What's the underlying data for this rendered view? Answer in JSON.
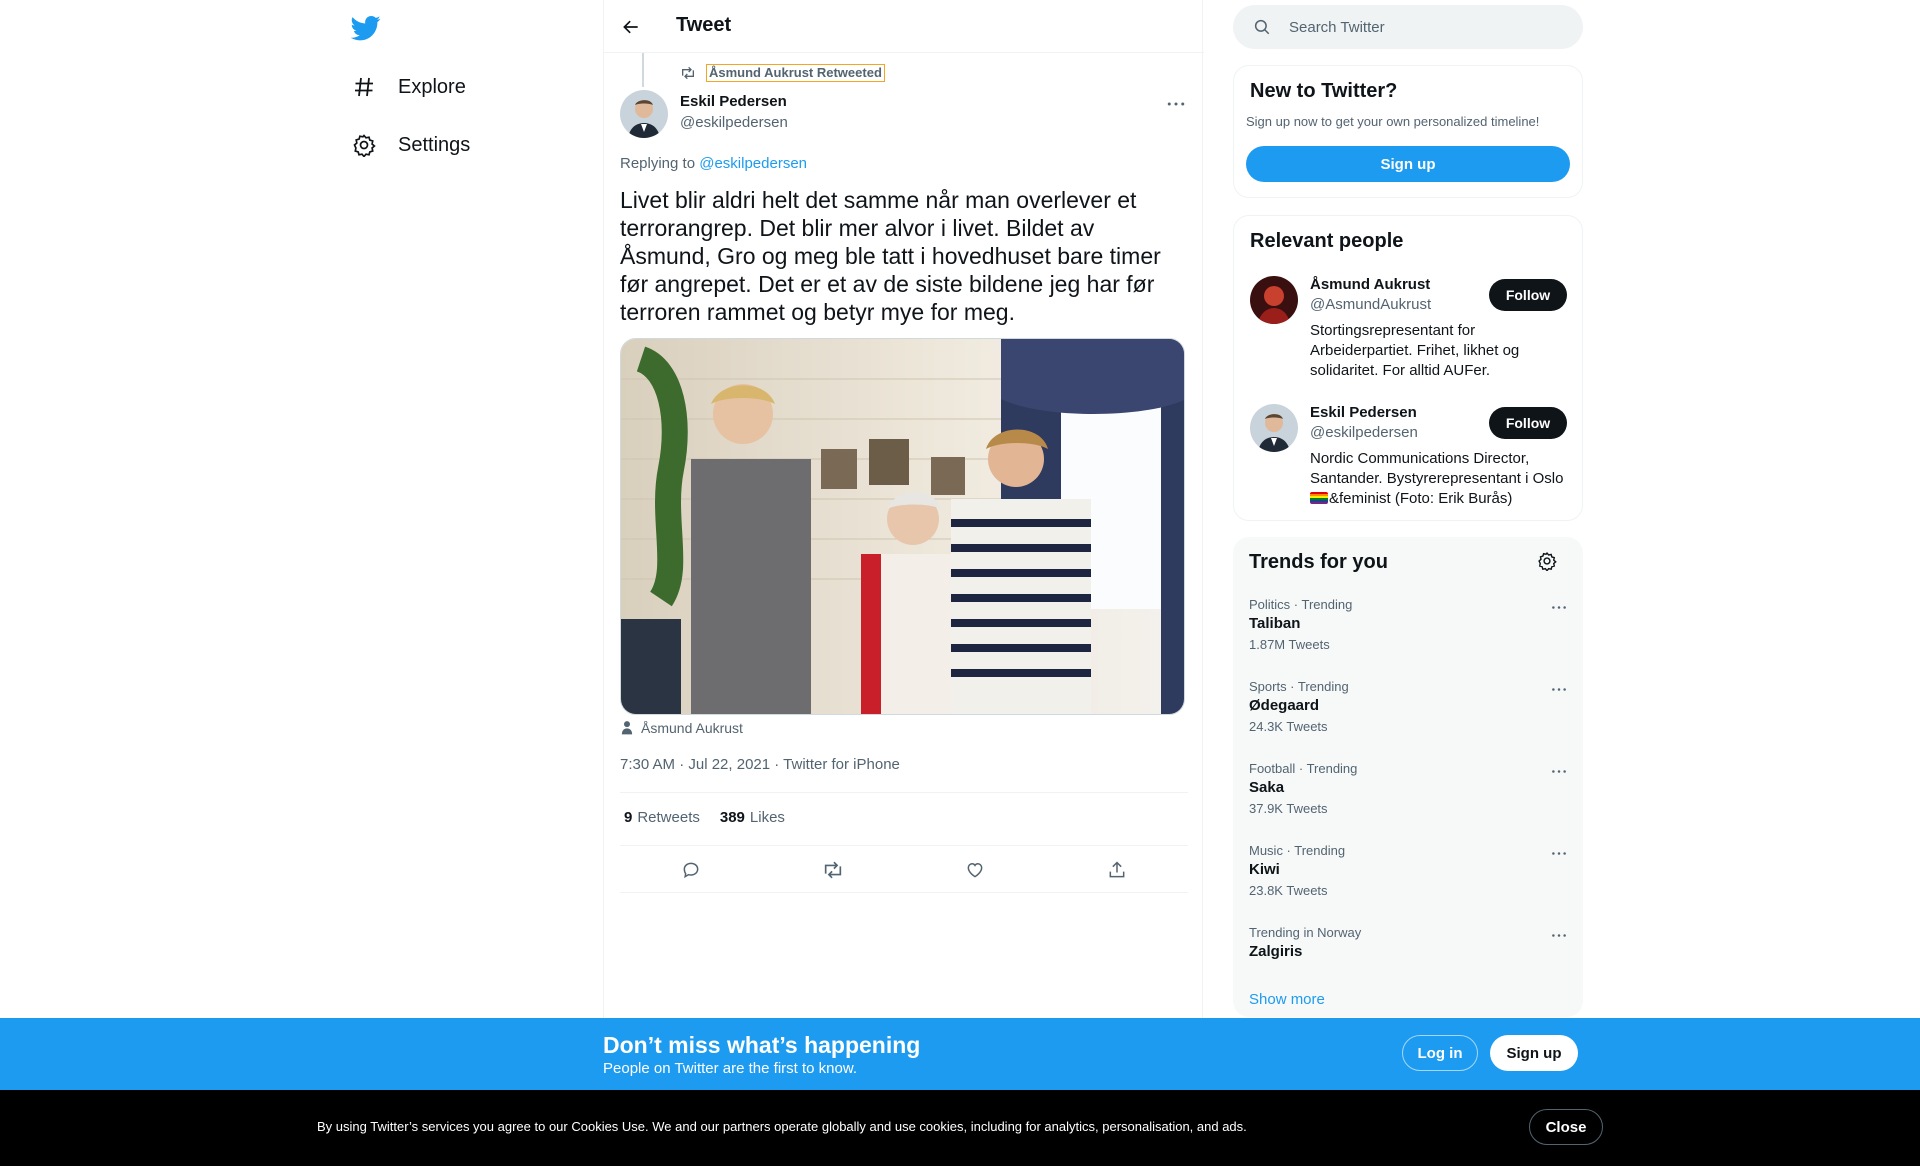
{
  "nav": {
    "items": [
      {
        "label": "Explore",
        "icon": "hashtag-icon"
      },
      {
        "label": "Settings",
        "icon": "gear-icon"
      }
    ]
  },
  "header": {
    "title": "Tweet"
  },
  "tweet": {
    "retweeted_by": "Åsmund Aukrust Retweeted",
    "author_name": "Eskil Pedersen",
    "author_handle": "@eskilpedersen",
    "replying_prefix": "Replying to",
    "replying_to": "@eskilpedersen",
    "text": "Livet blir aldri helt det samme når man overlever et terrorangrep. Det blir mer alvor i livet. Bildet av Åsmund, Gro og meg ble tatt i hovedhuset bare timer før angrepet. Det er et av de siste bildene jeg har før terroren rammet og betyr mye for meg.",
    "tagged_person": "Åsmund Aukrust",
    "meta": "7:30 AM · Jul 22, 2021 · Twitter for iPhone",
    "retweets_count": "9",
    "retweets_label": "Retweets",
    "likes_count": "389",
    "likes_label": "Likes"
  },
  "search": {
    "placeholder": "Search Twitter"
  },
  "new_to_twitter": {
    "title": "New to Twitter?",
    "subtitle": "Sign up now to get your own personalized timeline!",
    "signup_label": "Sign up"
  },
  "relevant_people": {
    "title": "Relevant people",
    "people": [
      {
        "name": "Åsmund Aukrust",
        "handle": "@AsmundAukrust",
        "bio": "Stortingsrepresentant for Arbeiderpartiet. Frihet, likhet og solidaritet. For alltid AUFer.",
        "follow_label": "Follow"
      },
      {
        "name": "Eskil Pedersen",
        "handle": "@eskilpedersen",
        "bio": "Nordic Communications Director, Santander. Bystyrerepresentant i Oslo",
        "bio2": "&feminist (Foto: Erik Burås)",
        "follow_label": "Follow"
      }
    ]
  },
  "trends": {
    "title": "Trends for you",
    "items": [
      {
        "context": "Politics · Trending",
        "name": "Taliban",
        "count": "1.87M Tweets"
      },
      {
        "context": "Sports · Trending",
        "name": "Ødegaard",
        "count": "24.3K Tweets"
      },
      {
        "context": "Football · Trending",
        "name": "Saka",
        "count": "37.9K Tweets"
      },
      {
        "context": "Music · Trending",
        "name": "Kiwi",
        "count": "23.8K Tweets"
      },
      {
        "context": "Trending in Norway",
        "name": "Zalgiris",
        "count": ""
      }
    ],
    "show_more": "Show more"
  },
  "promo": {
    "title": "Don’t miss what’s happening",
    "subtitle": "People on Twitter are the first to know.",
    "login_label": "Log in",
    "signup_label": "Sign up"
  },
  "cookie": {
    "text": "By using Twitter’s services you agree to our Cookies Use. We and our partners operate globally and use cookies, including for analytics, personalisation, and ads.",
    "close_label": "Close"
  },
  "colors": {
    "accent": "#1d9bf0",
    "text": "#0f1419",
    "muted": "#536471",
    "cookie_bg": "#000000"
  }
}
